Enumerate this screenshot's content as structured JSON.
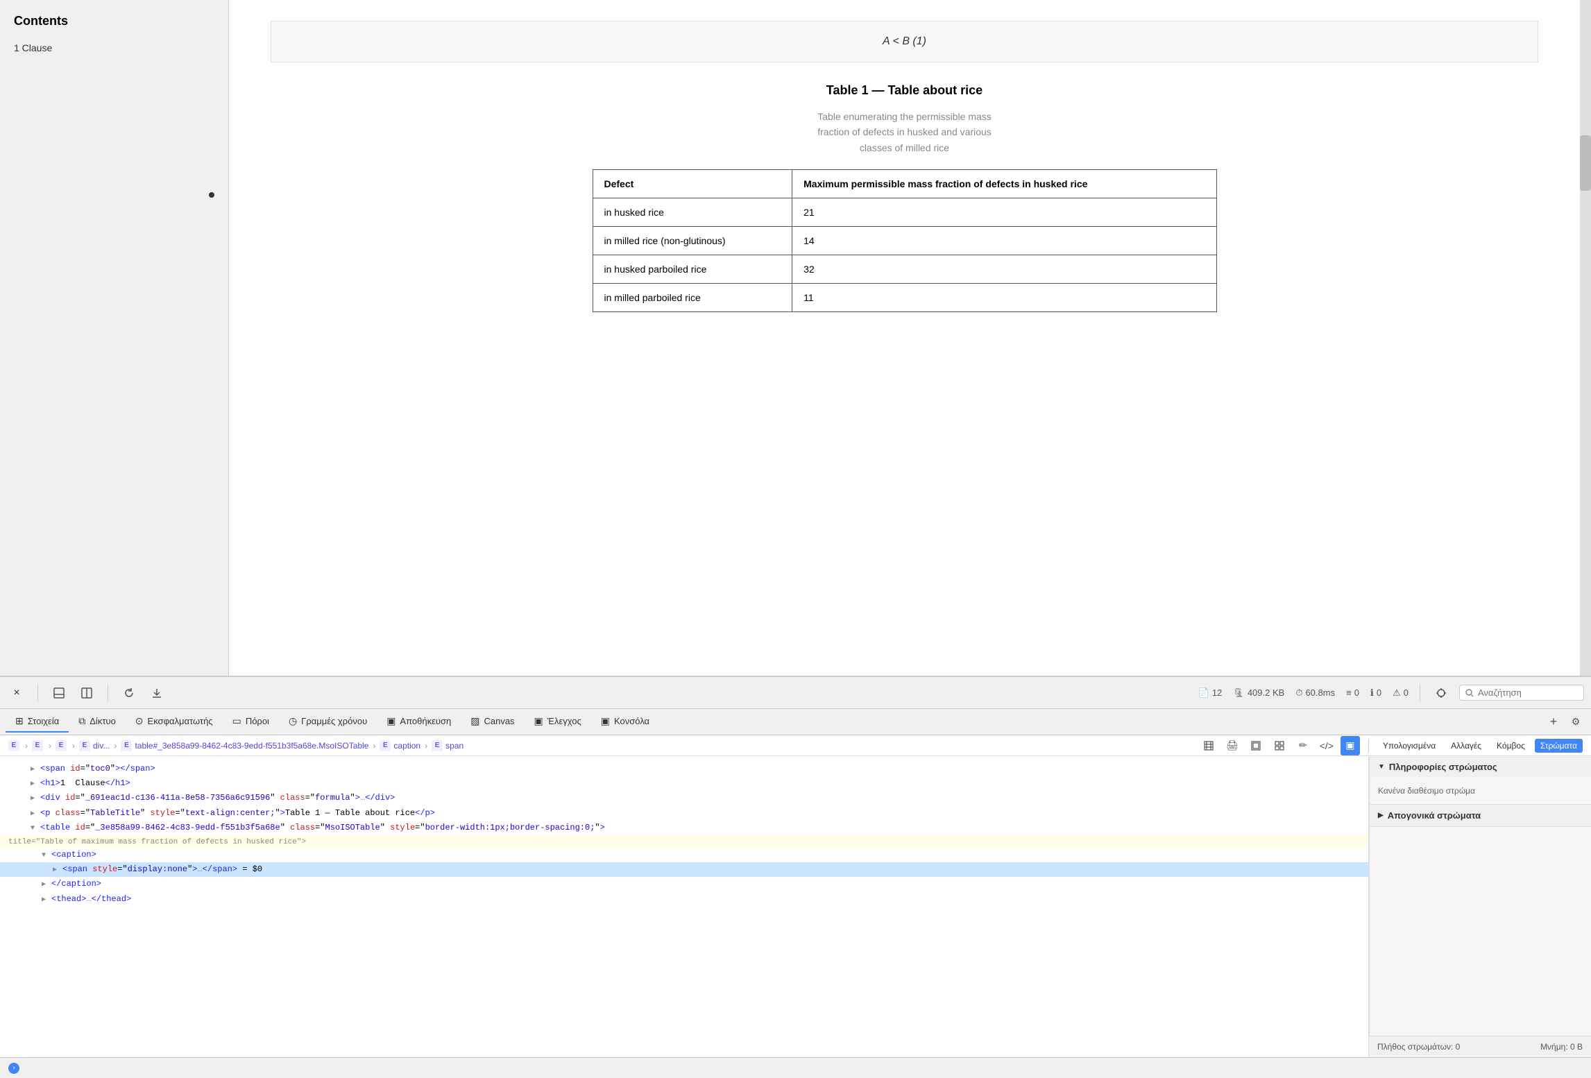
{
  "sidebar": {
    "title": "Contents",
    "items": [
      {
        "id": 1,
        "label": "1  Clause"
      }
    ]
  },
  "document": {
    "formula": "A < B (1)",
    "table_title": "Table 1 — Table about rice",
    "table_caption": "Table enumerating the permissible mass fraction of defects in husked and various classes of milled rice",
    "table": {
      "headers": [
        "Defect",
        "Maximum permissible mass fraction of defects in husked rice"
      ],
      "rows": [
        {
          "col1": "in husked rice",
          "col2": "21"
        },
        {
          "col1": "in milled rice (non-glutinous)",
          "col2": "14"
        },
        {
          "col1": "in husked parboiled rice",
          "col2": "32"
        },
        {
          "col1": "in milled parboiled rice",
          "col2": "11"
        }
      ]
    }
  },
  "devtools": {
    "toolbar": {
      "close_label": "×",
      "stats": {
        "pages": "12",
        "size": "409.2 KB",
        "time": "60.8ms",
        "requests": "0",
        "info": "0",
        "warnings": "0"
      },
      "search_placeholder": "Αναζήτηση"
    },
    "tabs": [
      {
        "label": "Στοιχεία",
        "icon": "⊞",
        "active": true
      },
      {
        "label": "Δίκτυο",
        "icon": "⧉"
      },
      {
        "label": "Εκσφαλματωτής",
        "icon": "⊙"
      },
      {
        "label": "Πόροι",
        "icon": "▭"
      },
      {
        "label": "Γραμμές χρόνου",
        "icon": "◷"
      },
      {
        "label": "Αποθήκευση",
        "icon": "▣"
      },
      {
        "label": "Canvas",
        "icon": "▨"
      },
      {
        "label": "Έλεγχος",
        "icon": "▣"
      },
      {
        "label": "Κονσόλα",
        "icon": "▣"
      }
    ],
    "breadcrumb": {
      "items": [
        {
          "label": "E",
          "type": "tag"
        },
        {
          "label": "E",
          "type": "tag"
        },
        {
          "label": "E",
          "type": "tag"
        },
        {
          "label": "div...",
          "type": "tag"
        },
        {
          "label": "table#_3e858a99-8462-4c83-9edd-f551b3f5a68e.MsoISOTable",
          "type": "tag"
        },
        {
          "label": "caption",
          "type": "tag"
        },
        {
          "label": "span",
          "type": "tag"
        }
      ]
    },
    "right_panel_buttons": [
      "Υπολογισμένα",
      "Αλλαγές",
      "Κόμβος",
      "Στρώματα"
    ],
    "right_panel": {
      "layers_title": "Πληροφορίες στρώματος",
      "layers_content": "Κανένα διαθέσιμο στρώμα",
      "descendant_title": "Απογονικά στρώματα",
      "footer": {
        "layers_count": "Πλήθος στρωμάτων: 0",
        "memory": "Μνήμη: 0 B"
      }
    },
    "code": {
      "lines": [
        {
          "indent": 1,
          "html": "<span id=\"toc0\"></span>",
          "type": "normal"
        },
        {
          "indent": 1,
          "html": "<h1>1  Clause</h1>",
          "type": "normal"
        },
        {
          "indent": 1,
          "html": "<div id=\"_691eac1d-c136-411a-8e58-7356a6c91596\" class=\"formula\">…</div>",
          "type": "normal"
        },
        {
          "indent": 1,
          "html": "<p class=\"TableTitle\" style=\"text-align:center;\">Table 1 — Table about rice</p>",
          "type": "normal"
        },
        {
          "indent": 1,
          "html": "<table id=\"_3e858a99-8462-4c83-9edd-f551b3f5a68e\" class=\"MsoISOTable\" style=\"border-width:1px;border-spacing:0;\" title=\"Table of maximum mass fraction of defects in husked rice\">",
          "type": "normal"
        },
        {
          "indent": 2,
          "html": "<caption>",
          "type": "normal"
        },
        {
          "indent": 3,
          "html": "<span style=\"display:none\">…</span> = $0",
          "type": "highlighted"
        },
        {
          "indent": 2,
          "html": "</caption>",
          "type": "normal"
        },
        {
          "indent": 2,
          "html": "<thead>…</thead>",
          "type": "normal"
        }
      ]
    }
  }
}
